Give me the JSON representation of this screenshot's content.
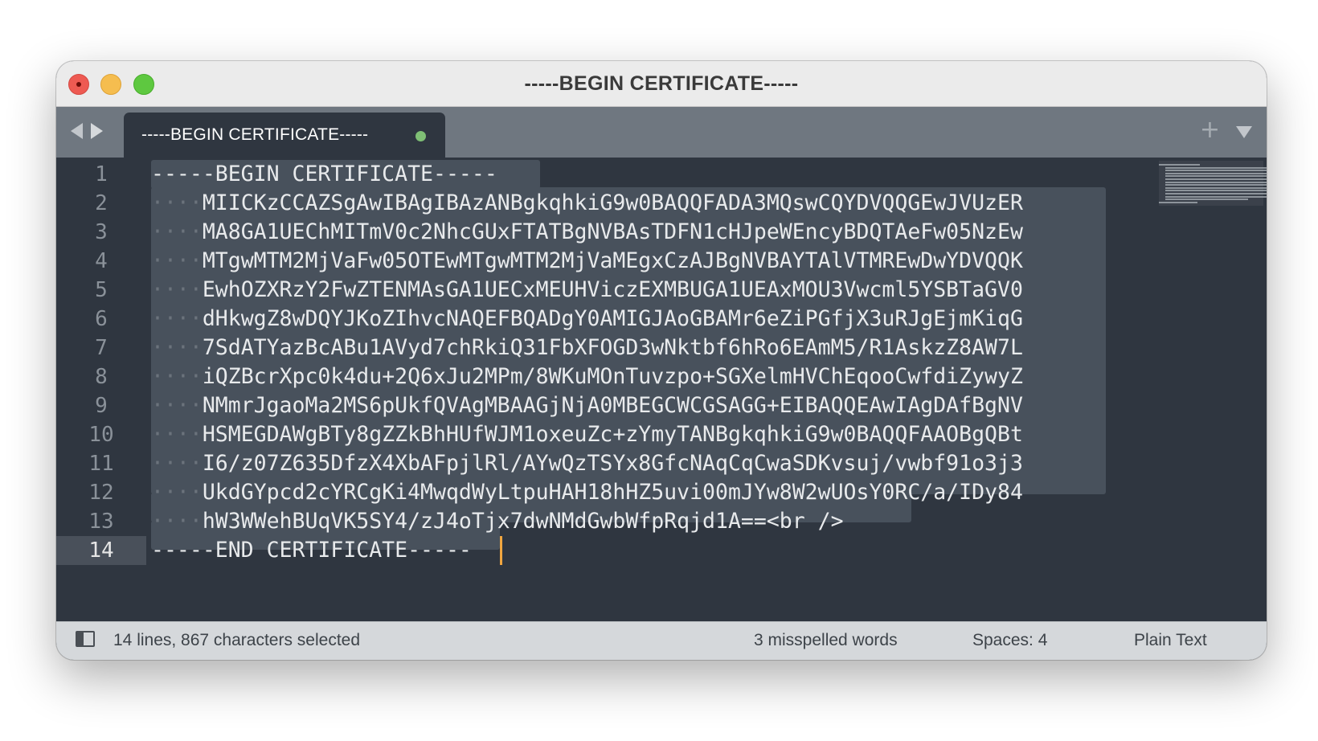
{
  "window": {
    "title": "-----BEGIN CERTIFICATE-----"
  },
  "tabs": [
    {
      "label": "-----BEGIN CERTIFICATE-----",
      "dirty": true
    }
  ],
  "editor": {
    "current_line": 14,
    "line_numbers": [
      "1",
      "2",
      "3",
      "4",
      "5",
      "6",
      "7",
      "8",
      "9",
      "10",
      "11",
      "12",
      "13",
      "14"
    ],
    "lines": [
      {
        "indent": "",
        "text": "-----BEGIN CERTIFICATE-----"
      },
      {
        "indent": "····",
        "text": "MIICKzCCAZSgAwIBAgIBAzANBgkqhkiG9w0BAQQFADA3MQswCQYDVQQGEwJVUzER"
      },
      {
        "indent": "····",
        "text": "MA8GA1UEChMITmV0c2NhcGUxFTATBgNVBAsTDFN1cHJpeWEncyBDQTAeFw05NzEw"
      },
      {
        "indent": "····",
        "text": "MTgwMTM2MjVaFw05OTEwMTgwMTM2MjVaMEgxCzAJBgNVBAYTAlVTMREwDwYDVQQK"
      },
      {
        "indent": "····",
        "text": "EwhOZXRzY2FwZTENMAsGA1UECxMEUHViczEXMBUGA1UEAxMOU3Vwcml5YSBTaGV0"
      },
      {
        "indent": "····",
        "text": "dHkwgZ8wDQYJKoZIhvcNAQEFBQADgY0AMIGJAoGBAMr6eZiPGfjX3uRJgEjmKiqG"
      },
      {
        "indent": "····",
        "text": "7SdATYazBcABu1AVyd7chRkiQ31FbXFOGD3wNktbf6hRo6EAmM5/R1AskzZ8AW7L"
      },
      {
        "indent": "····",
        "text": "iQZBcrXpc0k4du+2Q6xJu2MPm/8WKuMOnTuvzpo+SGXelmHVChEqooCwfdiZywyZ"
      },
      {
        "indent": "····",
        "text": "NMmrJgaoMa2MS6pUkfQVAgMBAAGjNjA0MBEGCWCGSAGG+EIBAQQEAwIAgDAfBgNV"
      },
      {
        "indent": "····",
        "text": "HSMEGDAWgBTy8gZZkBhHUfWJM1oxeuZc+zYmyTANBgkqhkiG9w0BAQQFAAOBgQBt"
      },
      {
        "indent": "····",
        "text": "I6/z07Z635DfzX4XbAFpjlRl/AYwQzTSYx8GfcNAqCqCwaSDKvsuj/vwbf91o3j3"
      },
      {
        "indent": "····",
        "text": "UkdGYpcd2cYRCgKi4MwqdWyLtpuHAH18hHZ5uvi00mJYw8W2wUOsY0RC/a/IDy84"
      },
      {
        "indent": "····",
        "text": "hW3WWehBUqVK5SY4/zJ4oTjx7dwNMdGwbWfpRqjd1A==<br />"
      },
      {
        "indent": "",
        "text": "-----END CERTIFICATE-----"
      }
    ]
  },
  "statusbar": {
    "selection": "14 lines, 867 characters selected",
    "spelling": "3 misspelled words",
    "indentation": "Spaces: 4",
    "syntax": "Plain Text"
  },
  "colors": {
    "editor_bg": "#2f3640",
    "selection": "#48515c",
    "cursor": "#f0a640",
    "tab_bar": "#6f7780",
    "status_bar": "#d5d8db"
  },
  "icons": [
    "close-button-icon",
    "minimize-button-icon",
    "zoom-button-icon",
    "back-arrow-icon",
    "forward-arrow-icon",
    "plus-icon",
    "dropdown-icon",
    "sidebar-toggle-icon"
  ]
}
